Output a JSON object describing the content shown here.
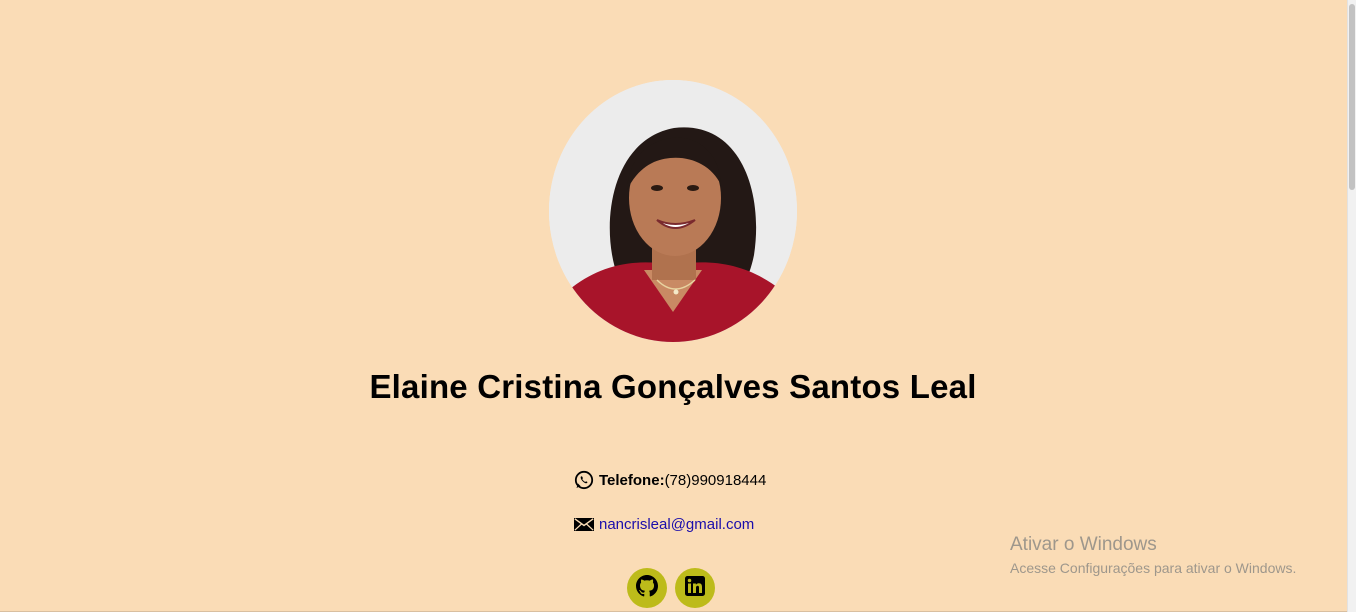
{
  "profile": {
    "name": "Elaine Cristina Gonçalves Santos Leal",
    "avatar_icon": "profile-photo"
  },
  "contact": {
    "phone_label": "Telefone:",
    "phone_value": "(78)990918444",
    "phone_icon": "whatsapp-icon",
    "email": "nancrisleal@gmail.com",
    "email_icon": "envelope-icon"
  },
  "social": [
    {
      "name": "github-icon"
    },
    {
      "name": "linkedin-icon"
    }
  ],
  "watermark": {
    "title": "Ativar o Windows",
    "subtitle": "Acesse Configurações para ativar o Windows."
  },
  "colors": {
    "background": "#FADCB6",
    "social_button": "#BDBB1A",
    "link": "#1A0DAB"
  }
}
